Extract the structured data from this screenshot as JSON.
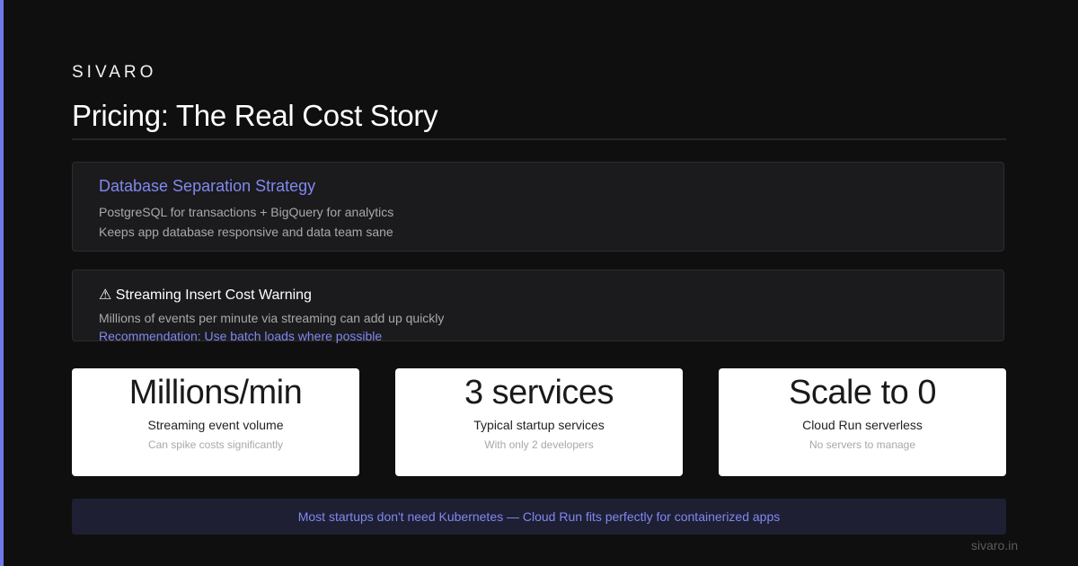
{
  "brand": "SIVARO",
  "title": "Pricing: The Real Cost Story",
  "cards": [
    {
      "title": "Database Separation Strategy",
      "lines": [
        "PostgreSQL for transactions + BigQuery for analytics",
        "Keeps app database responsive and data team sane"
      ]
    },
    {
      "title": "⚠ Streaming Insert Cost Warning",
      "lines": [
        "Millions of events per minute via streaming can add up quickly",
        "Recommendation: Use batch loads where possible"
      ]
    }
  ],
  "stats": [
    {
      "value": "Millions/min",
      "label": "Streaming event volume",
      "sub": "Can spike costs significantly"
    },
    {
      "value": "3 services",
      "label": "Typical startup services",
      "sub": "With only 2 developers"
    },
    {
      "value": "Scale to 0",
      "label": "Cloud Run serverless",
      "sub": "No servers to manage"
    }
  ],
  "banner": "Most startups don't need Kubernetes — Cloud Run fits perfectly for containerized apps",
  "footer": "sivaro.in",
  "colors": {
    "accent": "#6f78e8",
    "background": "#0f0f0f",
    "card": "#1b1b1d",
    "banner": "#1e1f33"
  }
}
